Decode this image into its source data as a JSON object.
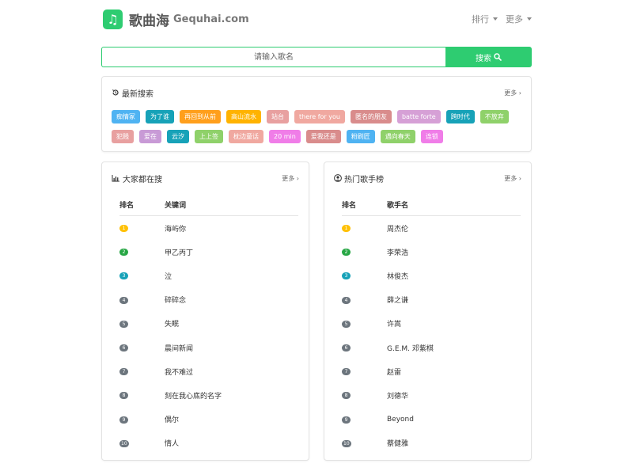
{
  "brand": {
    "logo_glyph": "♫",
    "name": "歌曲海",
    "domain": "Gequhai.com"
  },
  "nav": [
    {
      "label": "排行"
    },
    {
      "label": "更多"
    }
  ],
  "search": {
    "placeholder": "请输入歌名",
    "button_label": "搜索",
    "button_icon": "search-icon"
  },
  "recent": {
    "title": "最新搜索",
    "more": "更多 ›",
    "tags": [
      {
        "label": "痴情冢",
        "color": "#4fb3f2"
      },
      {
        "label": "为了谁",
        "color": "#17a2b8"
      },
      {
        "label": "再回到从前",
        "color": "#ff9f1c"
      },
      {
        "label": "高山流水",
        "color": "#ffb300"
      },
      {
        "label": "站台",
        "color": "#e8a0a0"
      },
      {
        "label": "there for you",
        "color": "#f0a8a0"
      },
      {
        "label": "匿名的朋友",
        "color": "#d98c8c"
      },
      {
        "label": "batte forte",
        "color": "#d6a0d6"
      },
      {
        "label": "跨时代",
        "color": "#17a2b8"
      },
      {
        "label": "不放弃",
        "color": "#8fd16a"
      },
      {
        "label": "犯贱",
        "color": "#e8a0a0"
      },
      {
        "label": "爱在",
        "color": "#c89ad6"
      },
      {
        "label": "云汐",
        "color": "#17a2b8"
      },
      {
        "label": "上上签",
        "color": "#8fd16a"
      },
      {
        "label": "枕边童话",
        "color": "#f0a8a0"
      },
      {
        "label": "20 min",
        "color": "#f07de8"
      },
      {
        "label": "爱我还是",
        "color": "#d98c8c"
      },
      {
        "label": "粉刷匠",
        "color": "#4fb3f2"
      },
      {
        "label": "遇向春天",
        "color": "#8fd16a"
      },
      {
        "label": "连锁",
        "color": "#f07de8"
      }
    ]
  },
  "popular": {
    "title": "大家都在搜",
    "more": "更多 ›",
    "col_rank": "排名",
    "col_name": "关键词",
    "rows": [
      {
        "rank": "1",
        "name": "海屿你",
        "color": "#ffc107"
      },
      {
        "rank": "2",
        "name": "甲乙丙丁",
        "color": "#28a745"
      },
      {
        "rank": "3",
        "name": "泣",
        "color": "#17a2b8"
      },
      {
        "rank": "4",
        "name": "碎碎念",
        "color": "#6c757d"
      },
      {
        "rank": "5",
        "name": "失眠",
        "color": "#6c757d"
      },
      {
        "rank": "6",
        "name": "晨间新闻",
        "color": "#6c757d"
      },
      {
        "rank": "7",
        "name": "我不难过",
        "color": "#6c757d"
      },
      {
        "rank": "8",
        "name": "刻在我心底的名字",
        "color": "#6c757d"
      },
      {
        "rank": "9",
        "name": "偶尔",
        "color": "#6c757d"
      },
      {
        "rank": "10",
        "name": "情人",
        "color": "#6c757d"
      }
    ]
  },
  "singers": {
    "title": "热门歌手榜",
    "more": "更多 ›",
    "col_rank": "排名",
    "col_name": "歌手名",
    "rows": [
      {
        "rank": "1",
        "name": "周杰伦",
        "color": "#ffc107"
      },
      {
        "rank": "2",
        "name": "李荣浩",
        "color": "#28a745"
      },
      {
        "rank": "3",
        "name": "林俊杰",
        "color": "#17a2b8"
      },
      {
        "rank": "4",
        "name": "薛之谦",
        "color": "#6c757d"
      },
      {
        "rank": "5",
        "name": "许嵩",
        "color": "#6c757d"
      },
      {
        "rank": "6",
        "name": "G.E.M. 邓紫棋",
        "color": "#6c757d"
      },
      {
        "rank": "7",
        "name": "赵雷",
        "color": "#6c757d"
      },
      {
        "rank": "8",
        "name": "刘德华",
        "color": "#6c757d"
      },
      {
        "rank": "9",
        "name": "Beyond",
        "color": "#6c757d"
      },
      {
        "rank": "10",
        "name": "蔡健雅",
        "color": "#6c757d"
      }
    ]
  }
}
